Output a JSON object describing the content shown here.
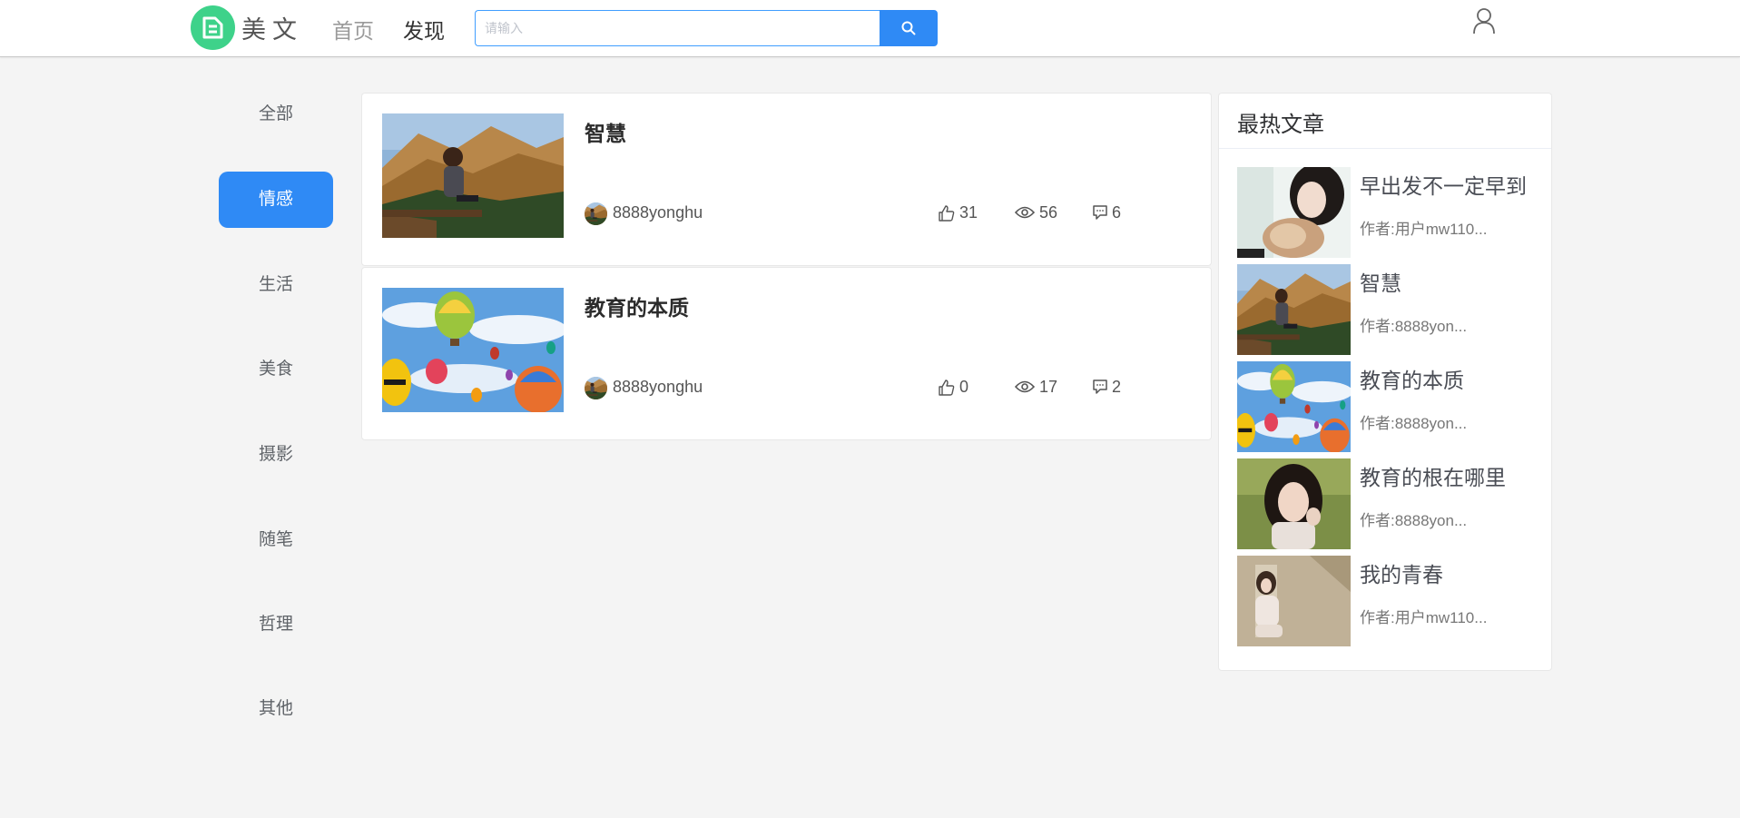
{
  "header": {
    "logo_text": "美文",
    "nav": [
      {
        "label": "首页"
      },
      {
        "label": "发现"
      }
    ],
    "search": {
      "placeholder": "请输入",
      "value": ""
    }
  },
  "categories": [
    {
      "label": "全部"
    },
    {
      "label": "情感"
    },
    {
      "label": "生活"
    },
    {
      "label": "美食"
    },
    {
      "label": "摄影"
    },
    {
      "label": "随笔"
    },
    {
      "label": "哲理"
    },
    {
      "label": "其他"
    }
  ],
  "articles": [
    {
      "title": "智慧",
      "author": "8888yonghu",
      "likes": "31",
      "views": "56",
      "comments": "6"
    },
    {
      "title": "教育的本质",
      "author": "8888yonghu",
      "likes": "0",
      "views": "17",
      "comments": "2"
    }
  ],
  "hot": {
    "heading": "最热文章",
    "items": [
      {
        "title": "早出发不一定早到",
        "author": "作者:用户mw110..."
      },
      {
        "title": "智慧",
        "author": "作者:8888yon..."
      },
      {
        "title": "教育的本质",
        "author": "作者:8888yon..."
      },
      {
        "title": "教育的根在哪里",
        "author": "作者:8888yon..."
      },
      {
        "title": "我的青春",
        "author": "作者:用户mw110..."
      }
    ]
  },
  "colors": {
    "accent": "#2f8af5",
    "logo_green": "#3ed28a",
    "page_background": "#f4f4f4"
  }
}
